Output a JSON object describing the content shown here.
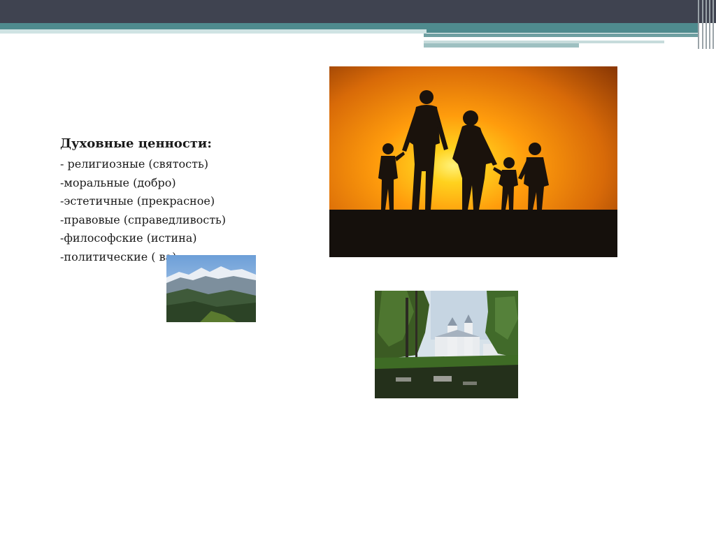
{
  "slide": {
    "heading": "Духовные ценности:",
    "items": [
      "- религиозные (святость)",
      "-моральные (добро)",
      "-эстетичные (прекрасное)",
      "-правовые (справедливость)",
      "-философские (истина)",
      "-политические (             ва)"
    ]
  },
  "images": {
    "sunset": "family-silhouette-sunset-photo",
    "mountain": "mountain-landscape-photo",
    "church": "church-in-trees-photo"
  }
}
